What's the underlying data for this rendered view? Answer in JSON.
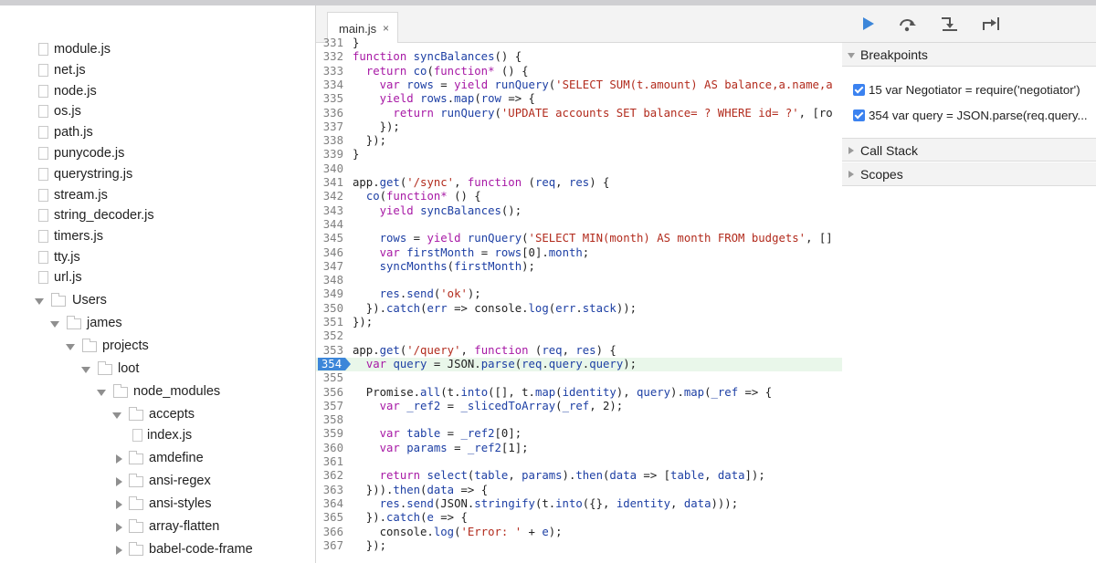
{
  "tree": {
    "items": [
      {
        "type": "file",
        "label": "module.js"
      },
      {
        "type": "file",
        "label": "net.js"
      },
      {
        "type": "file",
        "label": "node.js"
      },
      {
        "type": "file",
        "label": "os.js"
      },
      {
        "type": "file",
        "label": "path.js"
      },
      {
        "type": "file",
        "label": "punycode.js"
      },
      {
        "type": "file",
        "label": "querystring.js"
      },
      {
        "type": "file",
        "label": "stream.js"
      },
      {
        "type": "file",
        "label": "string_decoder.js"
      },
      {
        "type": "file",
        "label": "timers.js"
      },
      {
        "type": "file",
        "label": "tty.js"
      },
      {
        "type": "file",
        "label": "url.js"
      },
      {
        "type": "folder-open",
        "label": "Users"
      },
      {
        "type": "folder-open",
        "label": "james"
      },
      {
        "type": "folder-open",
        "label": "projects"
      },
      {
        "type": "folder-open",
        "label": "loot"
      },
      {
        "type": "folder-open",
        "label": "node_modules"
      },
      {
        "type": "folder-open",
        "label": "accepts"
      },
      {
        "type": "file",
        "label": "index.js"
      },
      {
        "type": "folder-closed",
        "label": "amdefine"
      },
      {
        "type": "folder-closed",
        "label": "ansi-regex"
      },
      {
        "type": "folder-closed",
        "label": "ansi-styles"
      },
      {
        "type": "folder-closed",
        "label": "array-flatten"
      },
      {
        "type": "folder-closed",
        "label": "babel-code-frame"
      }
    ]
  },
  "editor": {
    "tab": {
      "label": "main.js",
      "close": "×"
    },
    "current_line": "354",
    "lines": [
      {
        "n": "331",
        "t": "}"
      },
      {
        "n": "332",
        "t": "function syncBalances() {"
      },
      {
        "n": "333",
        "t": "  return co(function* () {"
      },
      {
        "n": "334",
        "t": "    var rows = yield runQuery('SELECT SUM(t.amount) AS balance,a.name,a"
      },
      {
        "n": "335",
        "t": "    yield rows.map(row => {"
      },
      {
        "n": "336",
        "t": "      return runQuery('UPDATE accounts SET balance= ? WHERE id= ?', [ro"
      },
      {
        "n": "337",
        "t": "    });"
      },
      {
        "n": "338",
        "t": "  });"
      },
      {
        "n": "339",
        "t": "}"
      },
      {
        "n": "340",
        "t": ""
      },
      {
        "n": "341",
        "t": "app.get('/sync', function (req, res) {"
      },
      {
        "n": "342",
        "t": "  co(function* () {"
      },
      {
        "n": "343",
        "t": "    yield syncBalances();"
      },
      {
        "n": "344",
        "t": ""
      },
      {
        "n": "345",
        "t": "    rows = yield runQuery('SELECT MIN(month) AS month FROM budgets', []"
      },
      {
        "n": "346",
        "t": "    var firstMonth = rows[0].month;"
      },
      {
        "n": "347",
        "t": "    syncMonths(firstMonth);"
      },
      {
        "n": "348",
        "t": ""
      },
      {
        "n": "349",
        "t": "    res.send('ok');"
      },
      {
        "n": "350",
        "t": "  }).catch(err => console.log(err.stack));"
      },
      {
        "n": "351",
        "t": "});"
      },
      {
        "n": "352",
        "t": ""
      },
      {
        "n": "353",
        "t": "app.get('/query', function (req, res) {"
      },
      {
        "n": "354",
        "t": "  var query = JSON.parse(req.query.query);"
      },
      {
        "n": "355",
        "t": ""
      },
      {
        "n": "356",
        "t": "  Promise.all(t.into([], t.map(identity), query).map(_ref => {"
      },
      {
        "n": "357",
        "t": "    var _ref2 = _slicedToArray(_ref, 2);"
      },
      {
        "n": "358",
        "t": ""
      },
      {
        "n": "359",
        "t": "    var table = _ref2[0];"
      },
      {
        "n": "360",
        "t": "    var params = _ref2[1];"
      },
      {
        "n": "361",
        "t": ""
      },
      {
        "n": "362",
        "t": "    return select(table, params).then(data => [table, data]);"
      },
      {
        "n": "363",
        "t": "  })).then(data => {"
      },
      {
        "n": "364",
        "t": "    res.send(JSON.stringify(t.into({}, identity, data)));"
      },
      {
        "n": "365",
        "t": "  }).catch(e => {"
      },
      {
        "n": "366",
        "t": "    console.log('Error: ' + e);"
      },
      {
        "n": "367",
        "t": "  });"
      }
    ]
  },
  "debugger": {
    "toolbar": [
      "resume-icon",
      "step-over-icon",
      "step-in-icon",
      "step-out-icon"
    ],
    "breakpoints_title": "Breakpoints",
    "breakpoints": [
      {
        "text": "15 var Negotiator = require('negotiator')",
        "checked": true
      },
      {
        "text": "354 var query = JSON.parse(req.query...",
        "checked": true
      }
    ],
    "call_stack_title": "Call Stack",
    "scopes_title": "Scopes"
  },
  "colors": {
    "keyword": "#a718a5",
    "function": "#1d3fa4",
    "string": "#b22b1d",
    "accent": "#3c86d9",
    "current_line_bg": "#e9f7ea"
  }
}
